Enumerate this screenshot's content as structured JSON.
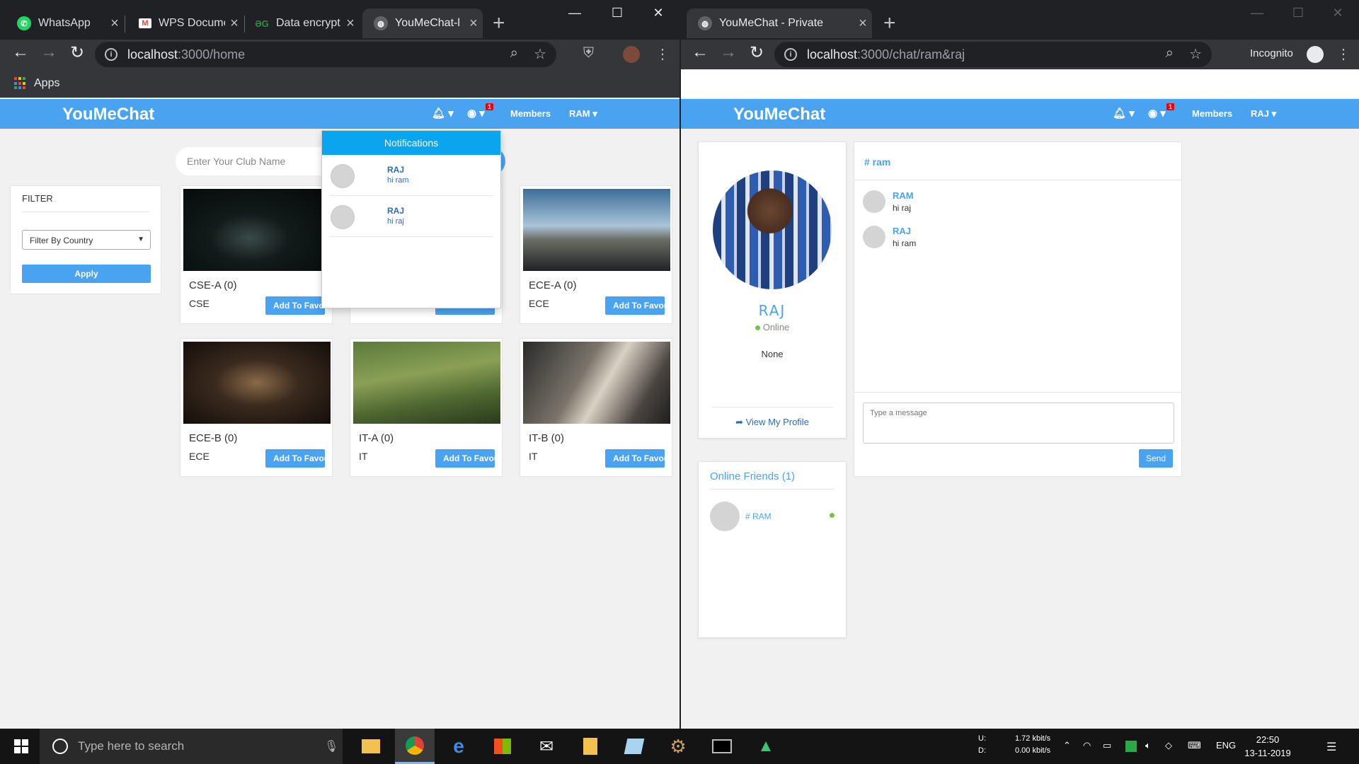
{
  "left_window": {
    "tabs": [
      {
        "title": "WhatsApp",
        "icon": "whatsapp-icon",
        "color": "#25d366"
      },
      {
        "title": "WPS Docume",
        "icon": "gmail-icon",
        "color": "#ea4335"
      },
      {
        "title": "Data encrypt",
        "icon": "gfg-icon",
        "color": "#2f8d46"
      },
      {
        "title": "YouMeChat-l",
        "icon": "globe-icon",
        "color": "#9aa0a6"
      }
    ],
    "url_host": "localhost",
    "url_path": ":3000/home",
    "bookmarks_apps": "Apps",
    "app": {
      "brand": "YouMeChat",
      "nav_members": "Members",
      "nav_user": "RAM ▾",
      "friend_badge": "1"
    },
    "filter": {
      "title": "FILTER",
      "select_value": "Filter By Country",
      "apply": "Apply"
    },
    "search_placeholder": "Enter Your Club Name",
    "clubs": [
      {
        "name": "CSE-A (0)",
        "country": "CSE",
        "button": "Add To Favourites"
      },
      {
        "name": "",
        "country": "",
        "button": "Add To Favourites"
      },
      {
        "name": "ECE-A (0)",
        "country": "ECE",
        "button": "Add To Favourites"
      },
      {
        "name": "ECE-B (0)",
        "country": "ECE",
        "button": "Add To Favourites"
      },
      {
        "name": "IT-A (0)",
        "country": "IT",
        "button": "Add To Favourites"
      },
      {
        "name": "IT-B (0)",
        "country": "IT",
        "button": "Add To Favourites"
      }
    ],
    "notifications": {
      "header": "Notifications",
      "items": [
        {
          "name": "RAJ",
          "message": "hi ram"
        },
        {
          "name": "RAJ",
          "message": "hi raj"
        }
      ]
    }
  },
  "right_window": {
    "tab_title": "YouMeChat - Private",
    "url_host": "localhost",
    "url_path": ":3000/chat/ram&raj",
    "incognito_label": "Incognito",
    "app": {
      "brand": "YouMeChat",
      "nav_members": "Members",
      "nav_user": "RAJ ▾",
      "friend_badge": "1"
    },
    "profile": {
      "name": "RAJ",
      "status": "Online",
      "about": "None",
      "view_profile": "View My Profile"
    },
    "online_friends": {
      "header": "Online Friends (1)",
      "items": [
        {
          "name": "# RAM"
        }
      ]
    },
    "chat": {
      "header": "# ram",
      "messages": [
        {
          "name": "RAM",
          "text": "hi raj"
        },
        {
          "name": "RAJ",
          "text": "hi ram"
        }
      ],
      "input_placeholder": "Type a message",
      "send": "Send"
    }
  },
  "taskbar": {
    "search_placeholder": "Type here to search",
    "net_up_label": "U:",
    "net_down_label": "D:",
    "net_up": "1.72 kbit/s",
    "net_down": "0.00 kbit/s",
    "lang": "ENG",
    "time": "22:50",
    "date": "13-11-2019"
  },
  "colors": {
    "brand_blue": "#4aa3f0",
    "notification_header": "#0ba4ee",
    "online_green": "#7cc04b",
    "badge_red": "#e00000"
  }
}
